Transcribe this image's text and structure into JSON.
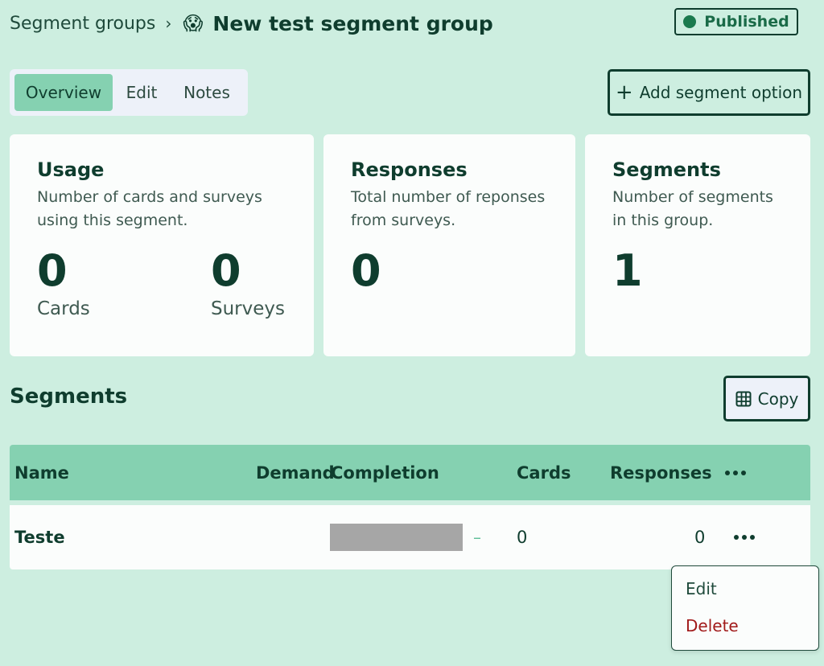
{
  "breadcrumb": {
    "parent": "Segment groups",
    "separator": "›",
    "emoji": "😱",
    "title": "New test segment group"
  },
  "status": {
    "label": "Published",
    "color": "#1a7a4e"
  },
  "tabs": [
    {
      "label": "Overview",
      "active": true
    },
    {
      "label": "Edit",
      "active": false
    },
    {
      "label": "Notes",
      "active": false
    }
  ],
  "add_button": {
    "icon": "plus-icon",
    "label": "Add segment option"
  },
  "cards": {
    "usage": {
      "title": "Usage",
      "description": "Number of cards and surveys using this segment.",
      "cards_value": "0",
      "cards_label": "Cards",
      "surveys_value": "0",
      "surveys_label": "Surveys"
    },
    "responses": {
      "title": "Responses",
      "description": "Total number of reponses from surveys.",
      "value": "0"
    },
    "segments": {
      "title": "Segments",
      "description": "Number of segments in this group.",
      "value": "1"
    }
  },
  "segments_section": {
    "title": "Segments",
    "copy_button": {
      "icon": "table-icon",
      "label": "Copy"
    }
  },
  "table": {
    "headers": [
      "Name",
      "Demand",
      "Completion",
      "Cards",
      "Responses"
    ],
    "rows": [
      {
        "name": "Teste",
        "completion_dash": "–",
        "cards": "0",
        "responses": "0"
      }
    ]
  },
  "row_menu": {
    "items": [
      {
        "label": "Edit",
        "color": "#1f4a3b"
      },
      {
        "label": "Delete",
        "color": "#a11a1a"
      }
    ]
  },
  "colors": {
    "background": "#cdeee0",
    "accent": "#85d1b1",
    "dark": "#0f3d2e",
    "danger": "#a11a1a"
  }
}
